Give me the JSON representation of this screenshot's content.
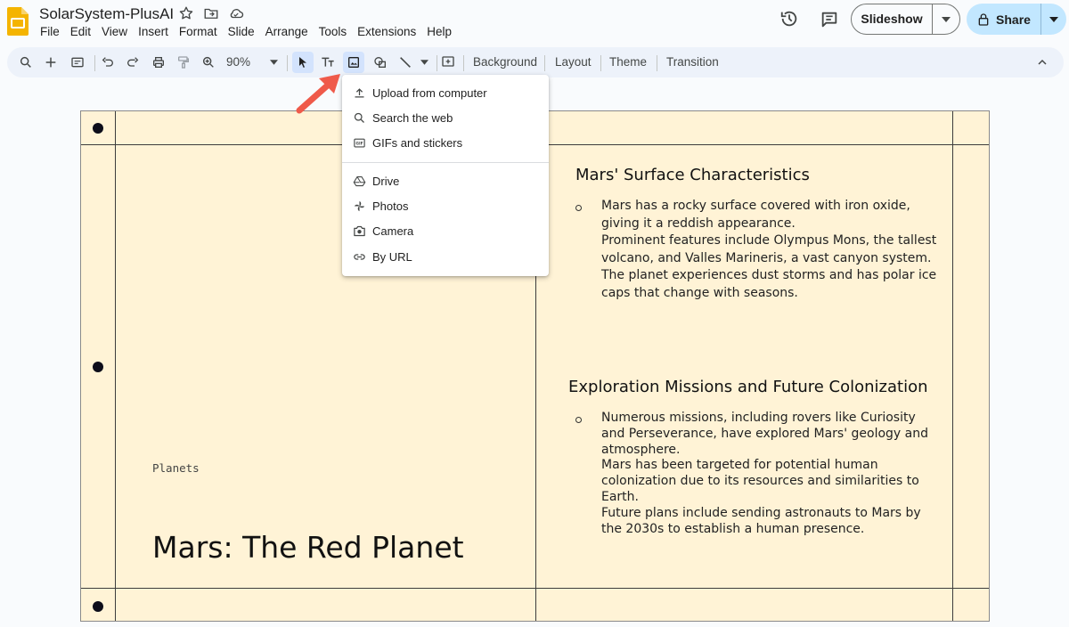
{
  "app": {
    "title": "SolarSystem-PlusAI",
    "menus": [
      "File",
      "Edit",
      "View",
      "Insert",
      "Format",
      "Slide",
      "Arrange",
      "Tools",
      "Extensions",
      "Help"
    ],
    "slideshow_label": "Slideshow",
    "share_label": "Share",
    "brand_color": "#f4b400",
    "share_color": "#c2e7ff"
  },
  "toolbar": {
    "zoom": "90%",
    "background_label": "Background",
    "layout_label": "Layout",
    "theme_label": "Theme",
    "transition_label": "Transition"
  },
  "image_menu": {
    "items": [
      {
        "label": "Upload from computer",
        "icon": "upload-icon"
      },
      {
        "label": "Search the web",
        "icon": "search-icon"
      },
      {
        "label": "GIFs and stickers",
        "icon": "gif-icon"
      },
      {
        "label": "Drive",
        "icon": "drive-icon"
      },
      {
        "label": "Photos",
        "icon": "photos-icon"
      },
      {
        "label": "Camera",
        "icon": "camera-icon"
      },
      {
        "label": "By URL",
        "icon": "link-icon"
      }
    ]
  },
  "slide": {
    "background": "#fff3d6",
    "overline": "Planets",
    "title": "Mars: The Red Planet",
    "sections": [
      {
        "heading": "Mars' Surface Characteristics",
        "lines": [
          "Mars has a rocky surface covered with iron oxide,",
          "giving it a reddish appearance.",
          "Prominent features include Olympus Mons, the tallest",
          "volcano, and Valles Marineris, a vast canyon system.",
          "The planet experiences dust storms and has polar ice",
          "caps that change with seasons."
        ]
      },
      {
        "heading": "Exploration Missions and Future Colonization",
        "lines": [
          "Numerous missions, including rovers like Curiosity",
          "and Perseverance, have explored Mars' geology and",
          "atmosphere.",
          "Mars has been targeted for potential human",
          "colonization due to its resources and similarities to",
          "Earth.",
          "Future plans include sending astronauts to Mars by",
          "the 2030s to establish a human presence."
        ]
      }
    ]
  }
}
